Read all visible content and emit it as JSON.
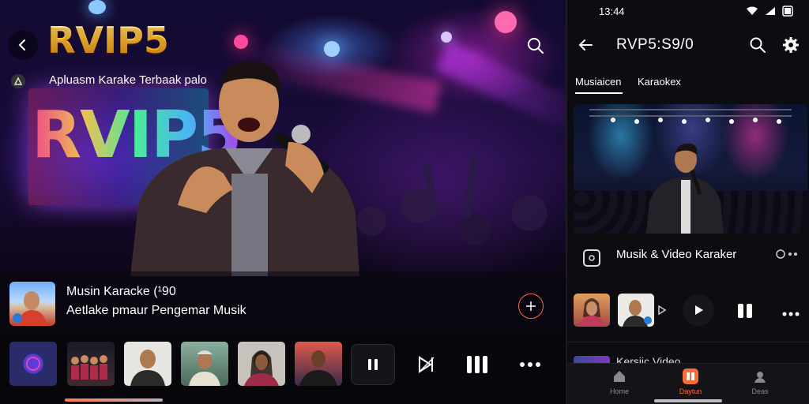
{
  "left": {
    "logo": "RVIP5",
    "subtitle": "Apluasm Karake Terbaak palo",
    "stage_sign": "RVIP5",
    "now_playing": {
      "title": "Musin Karacke (¹90",
      "subtitle": "Aetlake pmaur Pengemar Musik"
    },
    "icons": {
      "back": "back-arrow-icon",
      "search": "search-icon",
      "add": "add-icon",
      "pause": "pause-icon",
      "skip": "skip-icon",
      "bars": "bars-icon",
      "more": "more-icon"
    }
  },
  "right": {
    "status_time": "13:44",
    "header_title": "RVP5:S9/0",
    "tabs": [
      {
        "label": "Musiaicen",
        "active": true
      },
      {
        "label": "Karaokex",
        "active": false
      }
    ],
    "section_title": "Musik & Video Karaker",
    "section2_title": "Kersiic Video",
    "nav": [
      {
        "label": "Home",
        "icon": "home-icon"
      },
      {
        "label": "Daytun",
        "icon": "library-icon",
        "active": true
      },
      {
        "label": "Deas",
        "icon": "profile-icon"
      }
    ]
  },
  "colors": {
    "accent": "#ff6a3a",
    "logo_gold": "#ffcf3a",
    "panel_bg": "#0d0c10"
  }
}
